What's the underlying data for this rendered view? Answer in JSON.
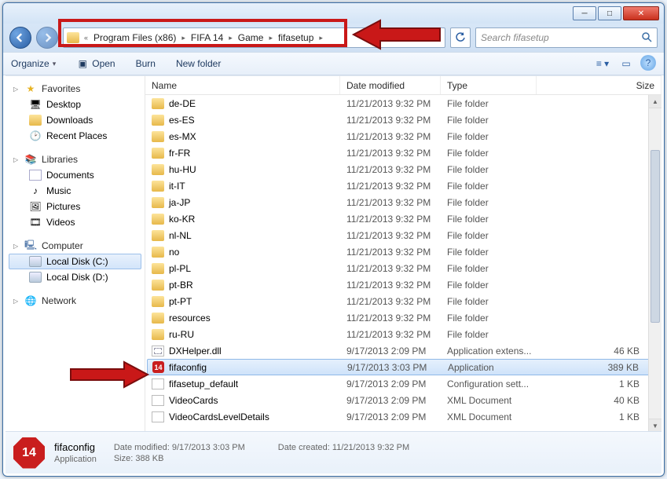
{
  "window": {
    "minimize": "─",
    "maximize": "□",
    "close": "✕"
  },
  "breadcrumb": {
    "overflow": "«",
    "segments": [
      "Program Files (x86)",
      "FIFA 14",
      "Game",
      "fifasetup"
    ]
  },
  "search": {
    "placeholder": "Search fifasetup"
  },
  "toolbar": {
    "organize": "Organize",
    "open": "Open",
    "burn": "Burn",
    "newfolder": "New folder"
  },
  "columns": {
    "name": "Name",
    "date": "Date modified",
    "type": "Type",
    "size": "Size"
  },
  "sidebar": {
    "favorites": "Favorites",
    "desktop": "Desktop",
    "downloads": "Downloads",
    "recent": "Recent Places",
    "libraries": "Libraries",
    "documents": "Documents",
    "music": "Music",
    "pictures": "Pictures",
    "videos": "Videos",
    "computer": "Computer",
    "cdrive": "Local Disk (C:)",
    "ddrive": "Local Disk (D:)",
    "network": "Network"
  },
  "files": [
    {
      "name": "de-DE",
      "date": "11/21/2013 9:32 PM",
      "type": "File folder",
      "size": "",
      "icon": "folder"
    },
    {
      "name": "es-ES",
      "date": "11/21/2013 9:32 PM",
      "type": "File folder",
      "size": "",
      "icon": "folder"
    },
    {
      "name": "es-MX",
      "date": "11/21/2013 9:32 PM",
      "type": "File folder",
      "size": "",
      "icon": "folder"
    },
    {
      "name": "fr-FR",
      "date": "11/21/2013 9:32 PM",
      "type": "File folder",
      "size": "",
      "icon": "folder"
    },
    {
      "name": "hu-HU",
      "date": "11/21/2013 9:32 PM",
      "type": "File folder",
      "size": "",
      "icon": "folder"
    },
    {
      "name": "it-IT",
      "date": "11/21/2013 9:32 PM",
      "type": "File folder",
      "size": "",
      "icon": "folder"
    },
    {
      "name": "ja-JP",
      "date": "11/21/2013 9:32 PM",
      "type": "File folder",
      "size": "",
      "icon": "folder"
    },
    {
      "name": "ko-KR",
      "date": "11/21/2013 9:32 PM",
      "type": "File folder",
      "size": "",
      "icon": "folder"
    },
    {
      "name": "nl-NL",
      "date": "11/21/2013 9:32 PM",
      "type": "File folder",
      "size": "",
      "icon": "folder"
    },
    {
      "name": "no",
      "date": "11/21/2013 9:32 PM",
      "type": "File folder",
      "size": "",
      "icon": "folder"
    },
    {
      "name": "pl-PL",
      "date": "11/21/2013 9:32 PM",
      "type": "File folder",
      "size": "",
      "icon": "folder"
    },
    {
      "name": "pt-BR",
      "date": "11/21/2013 9:32 PM",
      "type": "File folder",
      "size": "",
      "icon": "folder"
    },
    {
      "name": "pt-PT",
      "date": "11/21/2013 9:32 PM",
      "type": "File folder",
      "size": "",
      "icon": "folder"
    },
    {
      "name": "resources",
      "date": "11/21/2013 9:32 PM",
      "type": "File folder",
      "size": "",
      "icon": "folder"
    },
    {
      "name": "ru-RU",
      "date": "11/21/2013 9:32 PM",
      "type": "File folder",
      "size": "",
      "icon": "folder"
    },
    {
      "name": "DXHelper.dll",
      "date": "9/17/2013 2:09 PM",
      "type": "Application extens...",
      "size": "46 KB",
      "icon": "dll"
    },
    {
      "name": "fifaconfig",
      "date": "9/17/2013 3:03 PM",
      "type": "Application",
      "size": "389 KB",
      "icon": "app",
      "selected": true
    },
    {
      "name": "fifasetup_default",
      "date": "9/17/2013 2:09 PM",
      "type": "Configuration sett...",
      "size": "1 KB",
      "icon": "cfg"
    },
    {
      "name": "VideoCards",
      "date": "9/17/2013 2:09 PM",
      "type": "XML Document",
      "size": "40 KB",
      "icon": "xml"
    },
    {
      "name": "VideoCardsLevelDetails",
      "date": "9/17/2013 2:09 PM",
      "type": "XML Document",
      "size": "1 KB",
      "icon": "xml"
    }
  ],
  "details": {
    "name": "fifaconfig",
    "type": "Application",
    "modified_label": "Date modified:",
    "modified": "9/17/2013 3:03 PM",
    "size_label": "Size:",
    "size": "388 KB",
    "created_label": "Date created:",
    "created": "11/21/2013 9:32 PM",
    "iconnum": "14"
  }
}
